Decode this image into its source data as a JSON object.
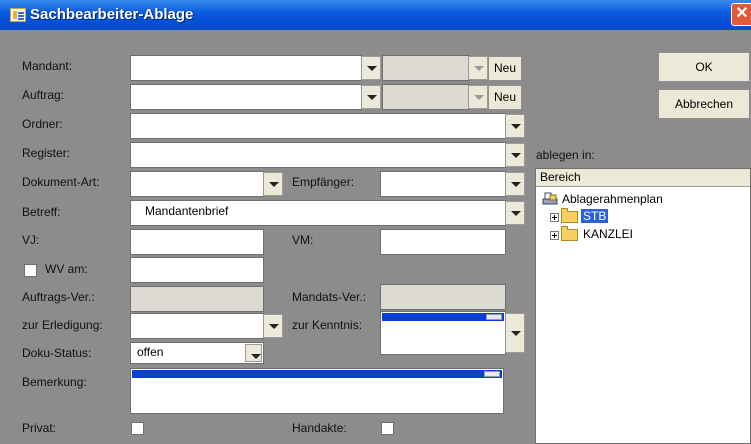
{
  "window": {
    "title": "Sachbearbeiter-Ablage",
    "close_glyph": "✕"
  },
  "labels": {
    "mandant": "Mandant:",
    "auftrag": "Auftrag:",
    "ordner": "Ordner:",
    "register": "Register:",
    "dokument_art": "Dokument-Art:",
    "empfaenger": "Empfänger:",
    "betreff": "Betreff:",
    "vj": "VJ:",
    "vm": "VM:",
    "wv_am": "WV am:",
    "auftrags_ver": "Auftrags-Ver.:",
    "mandats_ver": "Mandats-Ver.:",
    "zur_erledigung": "zur Erledigung:",
    "zur_kenntnis": "zur Kenntnis:",
    "doku_status": "Doku-Status:",
    "bemerkung": "Bemerkung:",
    "privat": "Privat:",
    "handakte": "Handakte:",
    "ablegen_in": "ablegen in:"
  },
  "fields": {
    "mandant": "",
    "auftrag": "",
    "ordner": "",
    "register": "",
    "dokument_art": "",
    "empfaenger": "",
    "betreff": "Mandantenbrief",
    "vj": "",
    "vm": "",
    "wv_am": "",
    "auftrags_ver": "",
    "mandats_ver": "",
    "zur_erledigung": "",
    "doku_status": "offen"
  },
  "checkboxes": {
    "wv_am": false,
    "privat": false,
    "handakte": false
  },
  "buttons": {
    "neu": "Neu",
    "ok": "OK",
    "abbrechen": "Abbrechen"
  },
  "tree": {
    "header": "Bereich",
    "root": "Ablagerahmenplan",
    "items": [
      {
        "label": "STB",
        "selected": true
      },
      {
        "label": "KANZLEI",
        "selected": false
      }
    ]
  },
  "colors": {
    "titlebar": "#0a5ce0",
    "selection": "#2f5fd6",
    "background": "#8c8c8c",
    "close": "#e15a35"
  },
  "icons": [
    "window-icon",
    "close-icon",
    "dropdown-arrow-icon",
    "tree-expand-icon",
    "folder-icon",
    "plan-icon"
  ]
}
